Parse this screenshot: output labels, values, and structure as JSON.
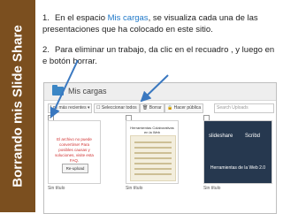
{
  "side_title": "Borrando mis Slide Share",
  "steps": [
    {
      "number": "1.",
      "text_before": "En el espacio ",
      "highlight": "Mis cargas",
      "text_after": ", se visualiza cada una de las presentaciones que ha colocado en este sitio."
    },
    {
      "number": "2.",
      "text": "Para eliminar un trabajo, da clic en el recuadro , y luego en e botón borrar."
    }
  ],
  "screenshot": {
    "title": "Mis cargas",
    "toolbar": {
      "filter": "Los más recientes",
      "select_all": "Seleccionar todos",
      "delete": "Borrar",
      "make_public": "Hacer pública",
      "search_placeholder": "Search Uploads"
    },
    "cards": [
      {
        "checked": "✓",
        "error_text": "El archivo no puede convertirse! Para posibles causas y soluciones, visite esta FAQ.",
        "reupload": "Re-upload",
        "label": "Sin título"
      },
      {
        "checked": "",
        "header_text": "Herramientas Colaborativas en la Web",
        "label": "Sin título"
      },
      {
        "checked": "",
        "logo_left": "slideshare",
        "logo_right": "Scribd",
        "title": "Herramientas de la Web 2.0",
        "label": "Sin título"
      }
    ]
  },
  "colors": {
    "side_band": "#7b4f1f",
    "highlight": "#1f78c8",
    "arrow": "#3a78c0",
    "error": "#d03030"
  }
}
